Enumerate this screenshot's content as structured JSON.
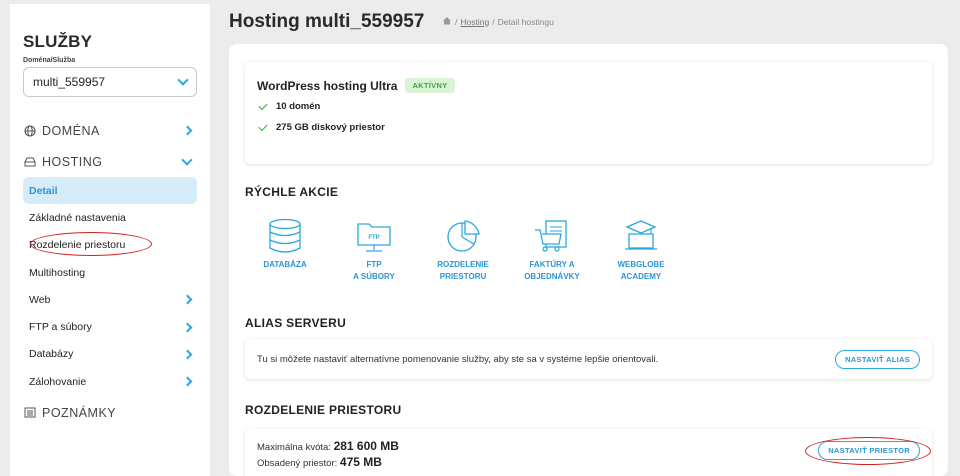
{
  "sidebar": {
    "title": "SLUŽBY",
    "select_label": "Doména/Služba",
    "select_value": "multi_559957",
    "sections": {
      "domena": "DOMÉNA",
      "hosting": "HOSTING",
      "poznamky": "POZNÁMKY"
    },
    "items": [
      {
        "label": "Detail"
      },
      {
        "label": "Základné nastavenia"
      },
      {
        "label": "Rozdelenie priestoru"
      },
      {
        "label": "Multihosting"
      },
      {
        "label": "Web"
      },
      {
        "label": "FTP a súbory"
      },
      {
        "label": "Databázy"
      },
      {
        "label": "Zálohovanie"
      }
    ]
  },
  "header": {
    "title": "Hosting multi_559957",
    "breadcrumb": {
      "home_icon": "home-icon",
      "sep": "/",
      "link": "Hosting",
      "current": "Detail hostingu"
    }
  },
  "plan": {
    "name": "WordPress hosting Ultra",
    "status": "AKTÍVNY",
    "features": [
      "10 domén",
      "275 GB diskový priestor"
    ]
  },
  "quick_actions": {
    "heading": "RÝCHLE AKCIE",
    "items": [
      {
        "line1": "DATABÁZA",
        "line2": "",
        "icon": "database-icon"
      },
      {
        "line1": "FTP",
        "line2": "A SÚBORY",
        "icon": "ftp-folder-icon"
      },
      {
        "line1": "ROZDELENIE",
        "line2": "PRIESTORU",
        "icon": "pie-chart-icon"
      },
      {
        "line1": "FAKTÚRY A",
        "line2": "OBJEDNÁVKY",
        "icon": "cart-invoice-icon"
      },
      {
        "line1": "WEBGLOBE",
        "line2": "ACADEMY",
        "icon": "academy-icon"
      }
    ]
  },
  "alias": {
    "heading": "ALIAS SERVERU",
    "text": "Tu si môžete nastaviť alternatívne pomenovanie služby, aby ste sa v systéme lepšie orientovali.",
    "button": "NASTAVIŤ ALIAS"
  },
  "space": {
    "heading": "ROZDELENIE PRIESTORU",
    "max_label": "Maximálna kvóta:",
    "max_value": "281 600 MB",
    "used_label": "Obsadený priestor:",
    "used_value": "475 MB",
    "button": "NASTAVIŤ PRIESTOR"
  },
  "colors": {
    "accent": "#2aa7de",
    "active_bg": "#d6ecf8",
    "highlight": "#d42020",
    "success": "#3aa63a"
  }
}
